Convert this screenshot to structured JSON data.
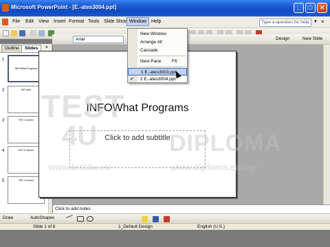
{
  "window": {
    "title": "Microsoft PowerPoint - [E.-ates3004.ppt]",
    "min_glyph": "_",
    "max_glyph": "□",
    "close_glyph": "✕"
  },
  "menubar": {
    "items": [
      "File",
      "Edit",
      "View",
      "Insert",
      "Format",
      "Tools",
      "Slide Show",
      "Window",
      "Help"
    ],
    "help_placeholder": "Type a question for help",
    "close_doc_glyph": "×"
  },
  "toolbar": {
    "font_name": "Arial",
    "design_label": "Design",
    "new_slide_label": "New Slide"
  },
  "window_menu": {
    "items": [
      {
        "label": "New Window",
        "shortcut": ""
      },
      {
        "label": "Arrange All",
        "shortcut": ""
      },
      {
        "label": "Cascade",
        "shortcut": ""
      },
      {
        "label": "Next Pane",
        "shortcut": "F6"
      },
      {
        "label": "1 E.-ates3003.ppt",
        "shortcut": ""
      },
      {
        "label": "2 E.-ates3004.ppt",
        "shortcut": ""
      }
    ],
    "checked_glyph": "✔"
  },
  "left_pane": {
    "tabs": [
      "Outline",
      "Slides"
    ],
    "close_glyph": "×",
    "thumbnails": [
      {
        "number": "1",
        "text": "INFOWhat Programs"
      },
      {
        "number": "2",
        "text": "PAT wide"
      },
      {
        "number": "3",
        "text": "PAT 2 column"
      },
      {
        "number": "4",
        "text": "PAT 3 Column"
      },
      {
        "number": "5",
        "text": "PAT 2 column"
      }
    ]
  },
  "slide": {
    "title": "INFOWhat Programs",
    "subtitle_placeholder": "Click to add subtitle"
  },
  "notes": {
    "placeholder": "Click to add notes"
  },
  "draw_toolbar": {
    "draw_label": "Draw",
    "autoshapes_label": "AutoShapes"
  },
  "statusbar": {
    "slide_info": "Slide 1 of 6",
    "design": "1_Default Design",
    "language": "English (U.S.)"
  },
  "watermark": {
    "line1": "TEST",
    "line2": "4U",
    "url1": "www.test4u.eu",
    "diploma": "DIPLOMA",
    "url2": "www.diploma.edu.gr"
  }
}
